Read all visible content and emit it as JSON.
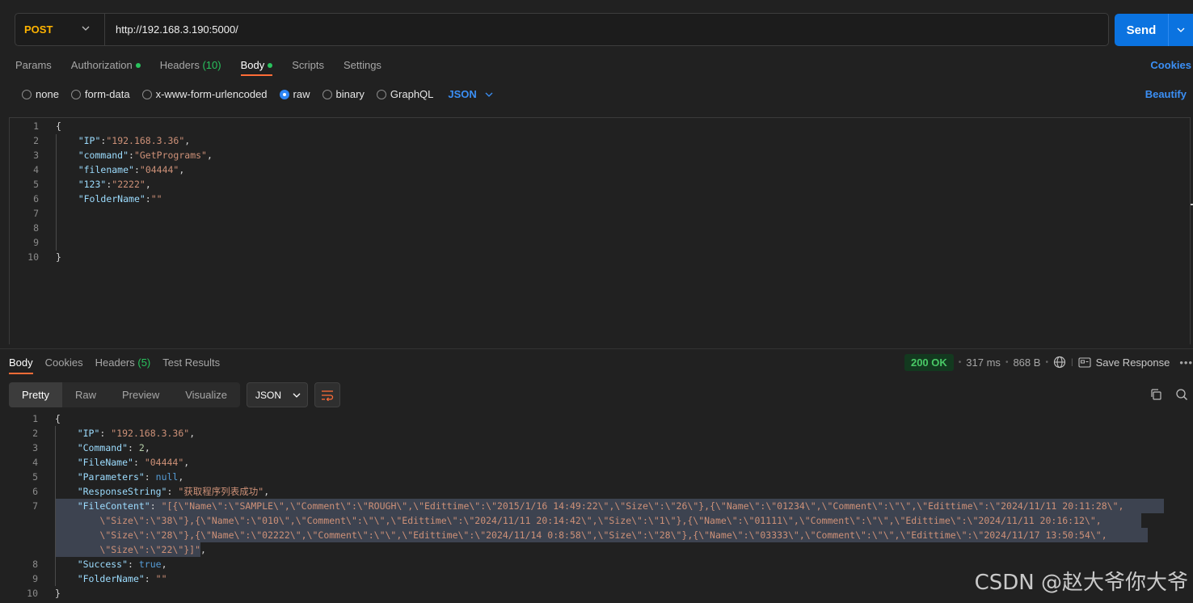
{
  "request": {
    "method": "POST",
    "url": "http://192.168.3.190:5000/",
    "send_label": "Send",
    "tabs": [
      {
        "label": "Params"
      },
      {
        "label": "Authorization"
      },
      {
        "label": "Headers",
        "count": "(10)"
      },
      {
        "label": "Body"
      },
      {
        "label": "Scripts"
      },
      {
        "label": "Settings"
      }
    ],
    "cookies_label": "Cookies",
    "body_types": [
      "none",
      "form-data",
      "x-www-form-urlencoded",
      "raw",
      "binary",
      "GraphQL"
    ],
    "selected_body_type": "raw",
    "language": "JSON",
    "beautify_label": "Beautify",
    "body_lines": [
      {
        "n": "1",
        "segs": [
          {
            "t": "{",
            "c": "p"
          }
        ]
      },
      {
        "n": "2",
        "segs": [
          {
            "t": "    ",
            "c": "p"
          },
          {
            "t": "\"IP\"",
            "c": "k"
          },
          {
            "t": ":",
            "c": "p"
          },
          {
            "t": "\"192.168.3.36\"",
            "c": "s"
          },
          {
            "t": ",",
            "c": "p"
          }
        ]
      },
      {
        "n": "3",
        "segs": [
          {
            "t": "    ",
            "c": "p"
          },
          {
            "t": "\"command\"",
            "c": "k"
          },
          {
            "t": ":",
            "c": "p"
          },
          {
            "t": "\"GetPrograms\"",
            "c": "s"
          },
          {
            "t": ",",
            "c": "p"
          }
        ]
      },
      {
        "n": "4",
        "segs": [
          {
            "t": "    ",
            "c": "p"
          },
          {
            "t": "\"filename\"",
            "c": "k"
          },
          {
            "t": ":",
            "c": "p"
          },
          {
            "t": "\"04444\"",
            "c": "s"
          },
          {
            "t": ",",
            "c": "p"
          }
        ]
      },
      {
        "n": "5",
        "segs": [
          {
            "t": "    ",
            "c": "p"
          },
          {
            "t": "\"123\"",
            "c": "k"
          },
          {
            "t": ":",
            "c": "p"
          },
          {
            "t": "\"2222\"",
            "c": "s"
          },
          {
            "t": ",",
            "c": "p"
          }
        ]
      },
      {
        "n": "6",
        "segs": [
          {
            "t": "    ",
            "c": "p"
          },
          {
            "t": "\"FolderName\"",
            "c": "k"
          },
          {
            "t": ":",
            "c": "p"
          },
          {
            "t": "\"\"",
            "c": "s"
          }
        ]
      },
      {
        "n": "7",
        "segs": []
      },
      {
        "n": "8",
        "segs": []
      },
      {
        "n": "9",
        "segs": []
      },
      {
        "n": "10",
        "segs": [
          {
            "t": "}",
            "c": "p"
          }
        ]
      }
    ]
  },
  "response": {
    "tabs": [
      {
        "label": "Body"
      },
      {
        "label": "Cookies"
      },
      {
        "label": "Headers",
        "count": "(5)"
      },
      {
        "label": "Test Results"
      }
    ],
    "status": "200 OK",
    "time": "317 ms",
    "size": "868 B",
    "save_label": "Save Response",
    "view_modes": [
      "Pretty",
      "Raw",
      "Preview",
      "Visualize"
    ],
    "format": "JSON",
    "lines": [
      {
        "n": "1",
        "segs": [
          {
            "t": "{",
            "c": "p"
          }
        ]
      },
      {
        "n": "2",
        "segs": [
          {
            "t": "    ",
            "c": "p"
          },
          {
            "t": "\"IP\"",
            "c": "k"
          },
          {
            "t": ": ",
            "c": "p"
          },
          {
            "t": "\"192.168.3.36\"",
            "c": "s"
          },
          {
            "t": ",",
            "c": "p"
          }
        ]
      },
      {
        "n": "3",
        "segs": [
          {
            "t": "    ",
            "c": "p"
          },
          {
            "t": "\"Command\"",
            "c": "k"
          },
          {
            "t": ": ",
            "c": "p"
          },
          {
            "t": "2",
            "c": "n"
          },
          {
            "t": ",",
            "c": "p"
          }
        ]
      },
      {
        "n": "4",
        "segs": [
          {
            "t": "    ",
            "c": "p"
          },
          {
            "t": "\"FileName\"",
            "c": "k"
          },
          {
            "t": ": ",
            "c": "p"
          },
          {
            "t": "\"04444\"",
            "c": "s"
          },
          {
            "t": ",",
            "c": "p"
          }
        ]
      },
      {
        "n": "5",
        "segs": [
          {
            "t": "    ",
            "c": "p"
          },
          {
            "t": "\"Parameters\"",
            "c": "k"
          },
          {
            "t": ": ",
            "c": "p"
          },
          {
            "t": "null",
            "c": "kw"
          },
          {
            "t": ",",
            "c": "p"
          }
        ]
      },
      {
        "n": "6",
        "segs": [
          {
            "t": "    ",
            "c": "p"
          },
          {
            "t": "\"ResponseString\"",
            "c": "k"
          },
          {
            "t": ": ",
            "c": "p"
          },
          {
            "t": "\"获取程序列表成功\"",
            "c": "s"
          },
          {
            "t": ",",
            "c": "p"
          }
        ]
      },
      {
        "n": "7",
        "segs": [
          {
            "t": "    ",
            "c": "p"
          },
          {
            "t": "\"FileContent\"",
            "c": "k"
          },
          {
            "t": ": ",
            "c": "p"
          },
          {
            "t": "\"[{\\\"Name\\\":\\\"SAMPLE\\\",\\\"Comment\\\":\\\"ROUGH\\\",\\\"Edittime\\\":\\\"2015/1/16 14:49:22\\\",\\\"Size\\\":\\\"26\\\"},{\\\"Name\\\":\\\"01234\\\",\\\"Comment\\\":\\\"\\\",\\\"Edittime\\\":\\\"2024/11/11 20:11:28\\\",",
            "c": "s"
          }
        ]
      },
      {
        "n": "",
        "segs": [
          {
            "t": "        ",
            "c": "p"
          },
          {
            "t": "\\\"Size\\\":\\\"38\\\"},{\\\"Name\\\":\\\"010\\\",\\\"Comment\\\":\\\"\\\",\\\"Edittime\\\":\\\"2024/11/11 20:14:42\\\",\\\"Size\\\":\\\"1\\\"},{\\\"Name\\\":\\\"01111\\\",\\\"Comment\\\":\\\"\\\",\\\"Edittime\\\":\\\"2024/11/11 20:16:12\\\",",
            "c": "s"
          }
        ]
      },
      {
        "n": "",
        "segs": [
          {
            "t": "        ",
            "c": "p"
          },
          {
            "t": "\\\"Size\\\":\\\"28\\\"},{\\\"Name\\\":\\\"02222\\\",\\\"Comment\\\":\\\"\\\",\\\"Edittime\\\":\\\"2024/11/14 0:8:58\\\",\\\"Size\\\":\\\"28\\\"},{\\\"Name\\\":\\\"03333\\\",\\\"Comment\\\":\\\"\\\",\\\"Edittime\\\":\\\"2024/11/17 13:50:54\\\",",
            "c": "s"
          }
        ]
      },
      {
        "n": "",
        "segs": [
          {
            "t": "        ",
            "c": "p"
          },
          {
            "t": "\\\"Size\\\":\\\"22\\\"}]\"",
            "c": "s"
          },
          {
            "t": ",",
            "c": "p"
          }
        ]
      },
      {
        "n": "8",
        "segs": [
          {
            "t": "    ",
            "c": "p"
          },
          {
            "t": "\"Success\"",
            "c": "k"
          },
          {
            "t": ": ",
            "c": "p"
          },
          {
            "t": "true",
            "c": "kw"
          },
          {
            "t": ",",
            "c": "p"
          }
        ]
      },
      {
        "n": "9",
        "segs": [
          {
            "t": "    ",
            "c": "p"
          },
          {
            "t": "\"FolderName\"",
            "c": "k"
          },
          {
            "t": ": ",
            "c": "p"
          },
          {
            "t": "\"\"",
            "c": "s"
          }
        ]
      },
      {
        "n": "10",
        "segs": [
          {
            "t": "}",
            "c": "p"
          }
        ]
      }
    ]
  },
  "watermark": "CSDN @赵大爷你大爷",
  "colors": {
    "accent": "#ff6c37",
    "send": "#0b73e0",
    "method": "#ffb400",
    "status_ok": "#49c966",
    "link": "#3b8ff5"
  }
}
